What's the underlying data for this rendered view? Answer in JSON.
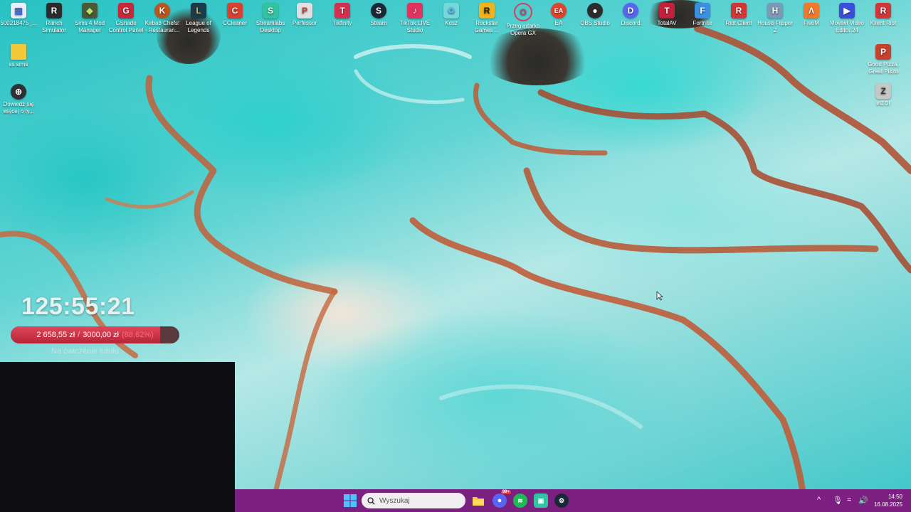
{
  "desktop": {
    "icons": [
      {
        "label": "500218475_..."
      },
      {
        "label": "Ranch Simulator",
        "glyph": "R"
      },
      {
        "label": "Sims 4 Mod Manager",
        "glyph": "◆"
      },
      {
        "label": "GShade Control Panel",
        "glyph": "G"
      },
      {
        "label": "Kebab Chefs! - Restauran...",
        "glyph": "K"
      },
      {
        "label": "League of Legends",
        "glyph": "L"
      },
      {
        "label": "CCleaner",
        "glyph": "C"
      },
      {
        "label": "Streamlabs Desktop",
        "glyph": "S"
      },
      {
        "label": "Perfessor",
        "glyph": "P"
      },
      {
        "label": "Tikfinity",
        "glyph": "T"
      },
      {
        "label": "Steam",
        "glyph": "S"
      },
      {
        "label": "TikTok LIVE Studio",
        "glyph": "♪"
      },
      {
        "label": "Kosz",
        "glyph": "♻"
      },
      {
        "label": "Rockstar Games ...",
        "glyph": "R"
      },
      {
        "label": "Przeglądarka Opera GX",
        "glyph": "O"
      },
      {
        "label": "EA",
        "glyph": "EA"
      },
      {
        "label": "OBS Studio",
        "glyph": "●"
      },
      {
        "label": "Discord",
        "glyph": "D"
      },
      {
        "label": "TotalAV",
        "glyph": "T"
      },
      {
        "label": "Fortnite",
        "glyph": "F"
      },
      {
        "label": "Riot Client",
        "glyph": "R"
      },
      {
        "label": "House Flipper 2",
        "glyph": "H"
      },
      {
        "label": "FiveM",
        "glyph": "Λ"
      },
      {
        "label": "Movavi Video Editor 24",
        "glyph": "▶"
      },
      {
        "label": "Klient Riot",
        "glyph": "R"
      },
      {
        "label": "ss sims"
      },
      {
        "label": "Dowiedz się więcej o ty..."
      },
      {
        "label": "Good Pizza, Great Pizza",
        "glyph": "P"
      },
      {
        "label": "inZOI",
        "glyph": "Z"
      }
    ]
  },
  "overlay": {
    "timer": "125:55:21",
    "goal_current": "2 658,55 zł",
    "goal_separator": "/",
    "goal_target": "3000,00 zł",
    "goal_percent": "(88.62%)",
    "goal_fraction": 0.8862,
    "goal_caption": "Na ćwiczenie tutułu"
  },
  "taskbar": {
    "search_placeholder": "Wyszukaj",
    "chat_badge": "99+",
    "clock_time": "14:50",
    "clock_date": "16.08.2025"
  },
  "colors": {
    "taskbar": "#7b1f80",
    "goal_fill": "#d23a4f"
  }
}
